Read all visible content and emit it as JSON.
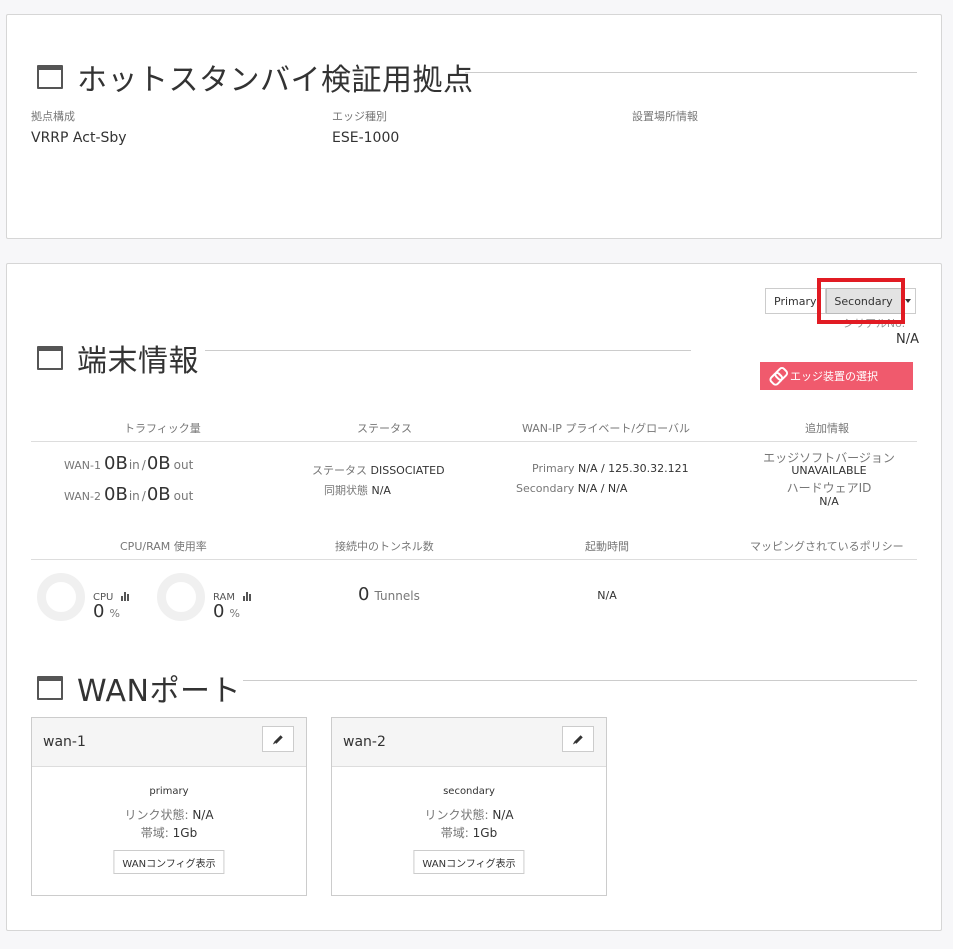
{
  "site": {
    "title": "ホットスタンバイ検証用拠点",
    "fields": [
      {
        "label": "拠点構成",
        "value": "VRRP Act-Sby"
      },
      {
        "label": "エッジ種別",
        "value": "ESE-1000"
      },
      {
        "label": "設置場所情報",
        "value": ""
      }
    ]
  },
  "device": {
    "title": "端末情報",
    "switch": {
      "primary": "Primary",
      "secondary": "Secondary"
    },
    "serial_label": "シリアルNo.",
    "serial_value": "N/A",
    "edge_select_label": "エッジ装置の選択",
    "columns": [
      "トラフィック量",
      "ステータス",
      "WAN-IP プライベート/グローバル",
      "追加情報"
    ],
    "traffic": [
      {
        "label": "WAN-1",
        "in_value": "0B",
        "in_unit": "in",
        "sep": "/",
        "out_value": "0B",
        "out_unit": "out"
      },
      {
        "label": "WAN-2",
        "in_value": "0B",
        "in_unit": "in",
        "sep": "/",
        "out_value": "0B",
        "out_unit": "out"
      }
    ],
    "status": [
      {
        "key": "ステータス",
        "value": "DISSOCIATED"
      },
      {
        "key": "同期状態",
        "value": "N/A"
      }
    ],
    "wan_ip": [
      {
        "key": "Primary",
        "value": "N/A / 125.30.32.121"
      },
      {
        "key": "Secondary",
        "value": "N/A / N/A"
      }
    ],
    "extra": {
      "sw_version_label": "エッジソフトバージョン",
      "sw_version_value": "UNAVAILABLE",
      "hw_id_label": "ハードウェアID",
      "hw_id_value": "N/A"
    },
    "columns2": [
      "CPU/RAM 使用率",
      "接続中のトンネル数",
      "起動時間",
      "マッピングされているポリシー"
    ],
    "cpu": {
      "label": "CPU",
      "value": "0",
      "unit": "%",
      "percent": 0
    },
    "ram": {
      "label": "RAM",
      "value": "0",
      "unit": "%",
      "percent": 0
    },
    "tunnels": {
      "value": "0",
      "unit": "Tunnels"
    },
    "uptime": "N/A"
  },
  "wan_ports": {
    "title": "WANポート",
    "cards": [
      {
        "name": "wan-1",
        "role": "primary",
        "link_label": "リンク状態:",
        "link_value": "N/A",
        "bw_label": "帯域:",
        "bw_value": "1Gb",
        "config_button": "WANコンフィグ表示"
      },
      {
        "name": "wan-2",
        "role": "secondary",
        "link_label": "リンク状態:",
        "link_value": "N/A",
        "bw_label": "帯域:",
        "bw_value": "1Gb",
        "config_button": "WANコンフィグ表示"
      }
    ]
  },
  "colors": {
    "accent_button": "#f05a6d",
    "highlight": "#e11b23"
  }
}
